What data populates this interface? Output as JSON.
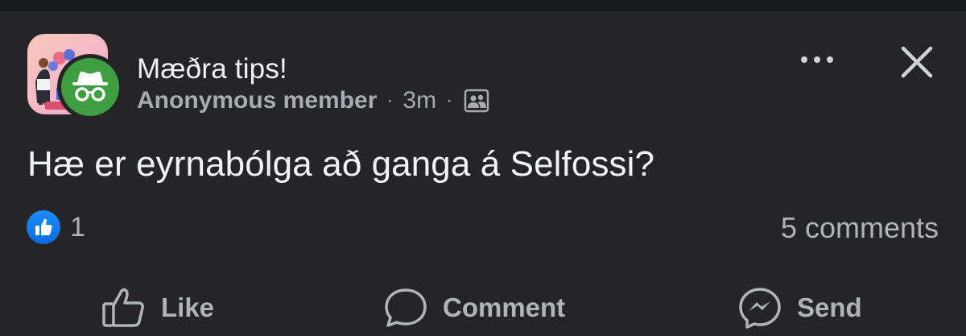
{
  "post": {
    "group_name": "Mæðra tips!",
    "author": "Anonymous member",
    "separator": "·",
    "time": "3m",
    "text": "Hæ er eyrnabólga að ganga á Selfossi?",
    "privacy_icon": "group-members-icon",
    "group_avatar_icon": "group-cover-illustration",
    "author_avatar_icon": "anonymous-incognito-icon"
  },
  "reactions": {
    "icon": "like-reaction-icon",
    "count": "1",
    "comments": "5 comments"
  },
  "actions": [
    {
      "label": "Like",
      "icon": "thumbs-up-icon"
    },
    {
      "label": "Comment",
      "icon": "comment-bubble-icon"
    },
    {
      "label": "Send",
      "icon": "messenger-icon"
    }
  ],
  "colors": {
    "background": "#252527",
    "badge_green": "#3e9e42",
    "like_blue": "#1877f2",
    "secondary_text": "#b0b3b8"
  }
}
